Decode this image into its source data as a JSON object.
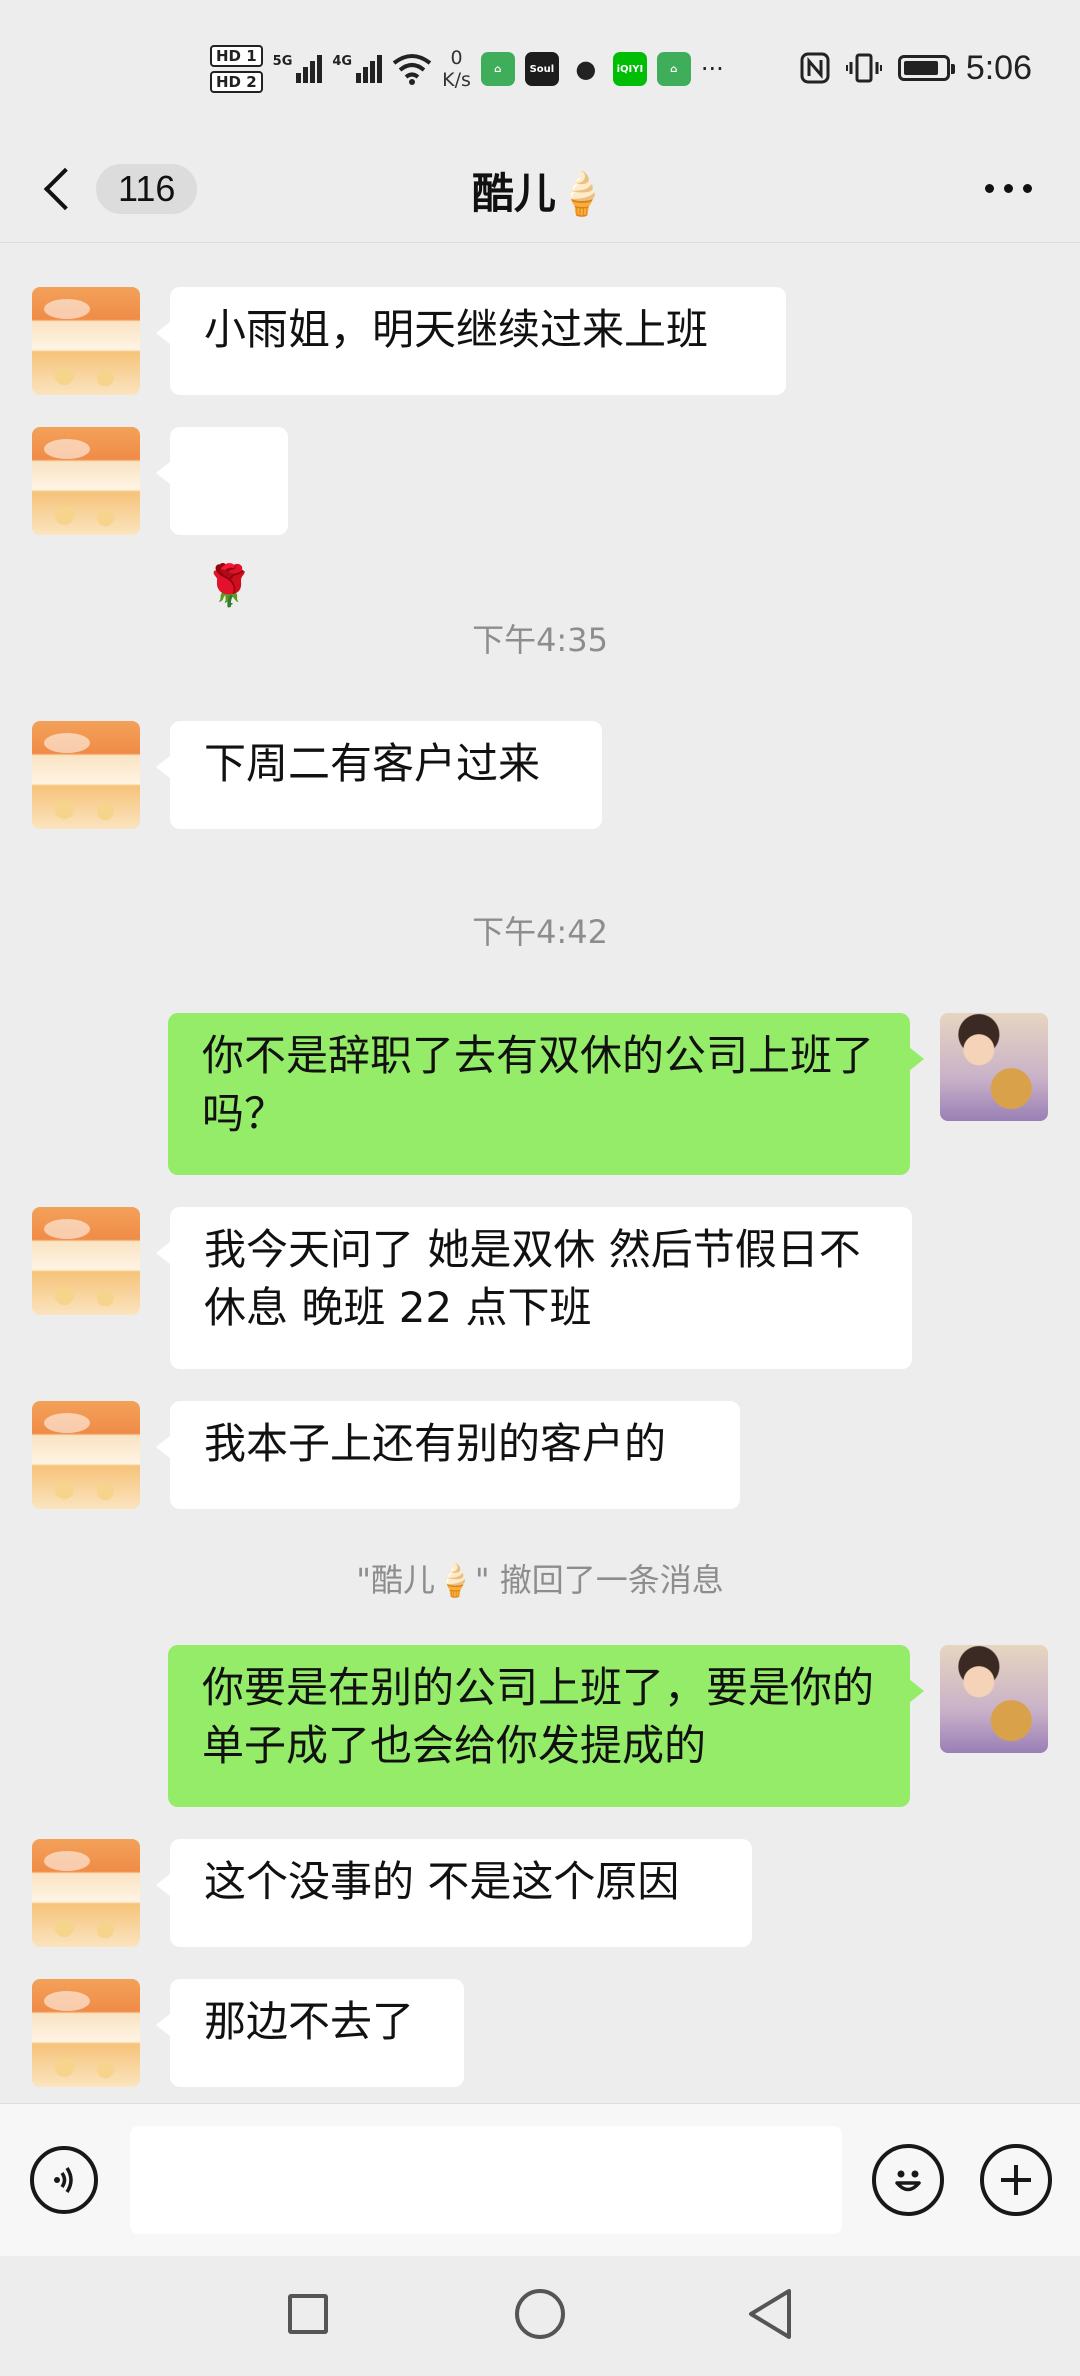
{
  "status_bar": {
    "hd1": "HD 1",
    "hd2": "HD 2",
    "signal1_label": "5G",
    "signal2_label": "4G",
    "net_speed_value": "0",
    "net_speed_unit": "K/s",
    "more": "···",
    "time": "5:06",
    "app_icons": [
      "home-app-icon",
      "soul-app-icon",
      "wechat-icon",
      "iqiyi-app-icon",
      "home-app-icon"
    ],
    "app_labels": {
      "soul": "Soul",
      "iqiyi": "iQIYI"
    },
    "icons": [
      "nfc-icon",
      "vibrate-icon",
      "battery-icon",
      "wifi-icon"
    ],
    "battery_level": 0.85
  },
  "header": {
    "back_icon": "chevron-left-icon",
    "unread_count": "116",
    "title": "酷儿🍦",
    "more_icon": "more-horizontal-icon"
  },
  "colors": {
    "page_bg": "#ededed",
    "incoming_bubble": "#ffffff",
    "outgoing_bubble": "#95ec69",
    "timestamp_text": "#8d8d8d"
  },
  "messages": [
    {
      "type": "incoming",
      "text": "小雨姐，明天继续过来上班"
    },
    {
      "type": "incoming",
      "text": "🌹"
    },
    {
      "type": "time",
      "text": "下午4:35"
    },
    {
      "type": "incoming",
      "text": "下周二有客户过来"
    },
    {
      "type": "time",
      "text": "下午4:42"
    },
    {
      "type": "outgoing",
      "text": "你不是辞职了去有双休的公司上班了吗？"
    },
    {
      "type": "incoming",
      "text": "我今天问了 她是双休 然后节假日不休息 晚班 22 点下班"
    },
    {
      "type": "incoming",
      "text": "我本子上还有别的客户的"
    },
    {
      "type": "system",
      "text": "\"酷儿🍦\" 撤回了一条消息"
    },
    {
      "type": "outgoing",
      "text": "你要是在别的公司上班了，要是你的单子成了也会给你发提成的"
    },
    {
      "type": "incoming",
      "text": "这个没事的 不是这个原因"
    },
    {
      "type": "incoming",
      "text": "那边不去了"
    }
  ],
  "input_bar": {
    "voice_icon": "voice-icon",
    "input_value": "",
    "emoji_icon": "emoji-icon",
    "plus_icon": "plus-icon"
  },
  "system_nav": {
    "recents_icon": "square-recents-icon",
    "home_icon": "circle-home-icon",
    "back_icon": "triangle-back-icon"
  }
}
